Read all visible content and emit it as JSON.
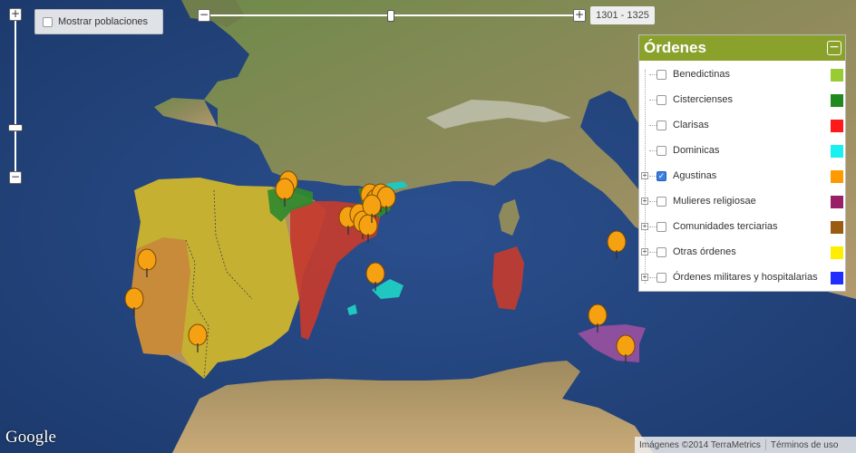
{
  "map": {
    "type": "satellite-map",
    "colors": {
      "sea": "#22427a",
      "land": "#a7916a",
      "orange": "#c98a33",
      "yellow": "#c8b42c",
      "red": "#c63b2e",
      "green": "#2f8a2c",
      "cyan": "#1fc7c0",
      "purple": "#8e4f9c",
      "marker": "#f5a111"
    },
    "markers_icon": "map-pin-icon"
  },
  "zoom": {
    "plus_icon": "plus-icon",
    "minus_icon": "minus-icon"
  },
  "timeline": {
    "range_label": "1301 - 1325",
    "minus_icon": "minus-icon",
    "plus_icon": "plus-icon"
  },
  "towns_toggle": {
    "label": "Mostrar poblaciones",
    "checked": false
  },
  "legend": {
    "title": "Órdenes",
    "collapse_icon": "minus-icon",
    "items": [
      {
        "label": "Benedictinas",
        "checked": false,
        "color": "#99cc33",
        "expandable": false
      },
      {
        "label": "Cistercienses",
        "checked": false,
        "color": "#1f8a1f",
        "expandable": false
      },
      {
        "label": "Clarisas",
        "checked": false,
        "color": "#ff1a1a",
        "expandable": false
      },
      {
        "label": "Dominicas",
        "checked": false,
        "color": "#19f0f0",
        "expandable": false
      },
      {
        "label": "Agustinas",
        "checked": true,
        "color": "#ff9900",
        "expandable": true
      },
      {
        "label": "Mulieres religiosae",
        "checked": false,
        "color": "#991f66",
        "expandable": true
      },
      {
        "label": "Comunidades terciarias",
        "checked": false,
        "color": "#995c11",
        "expandable": true
      },
      {
        "label": "Otras órdenes",
        "checked": false,
        "color": "#ffee00",
        "expandable": true
      },
      {
        "label": "Órdenes militares y hospitalarias",
        "checked": false,
        "color": "#1f2eff",
        "expandable": true
      }
    ]
  },
  "attribution": {
    "imagery": "Imágenes ©2014 TerraMetrics",
    "terms": "Términos de uso",
    "logo": "Google"
  }
}
